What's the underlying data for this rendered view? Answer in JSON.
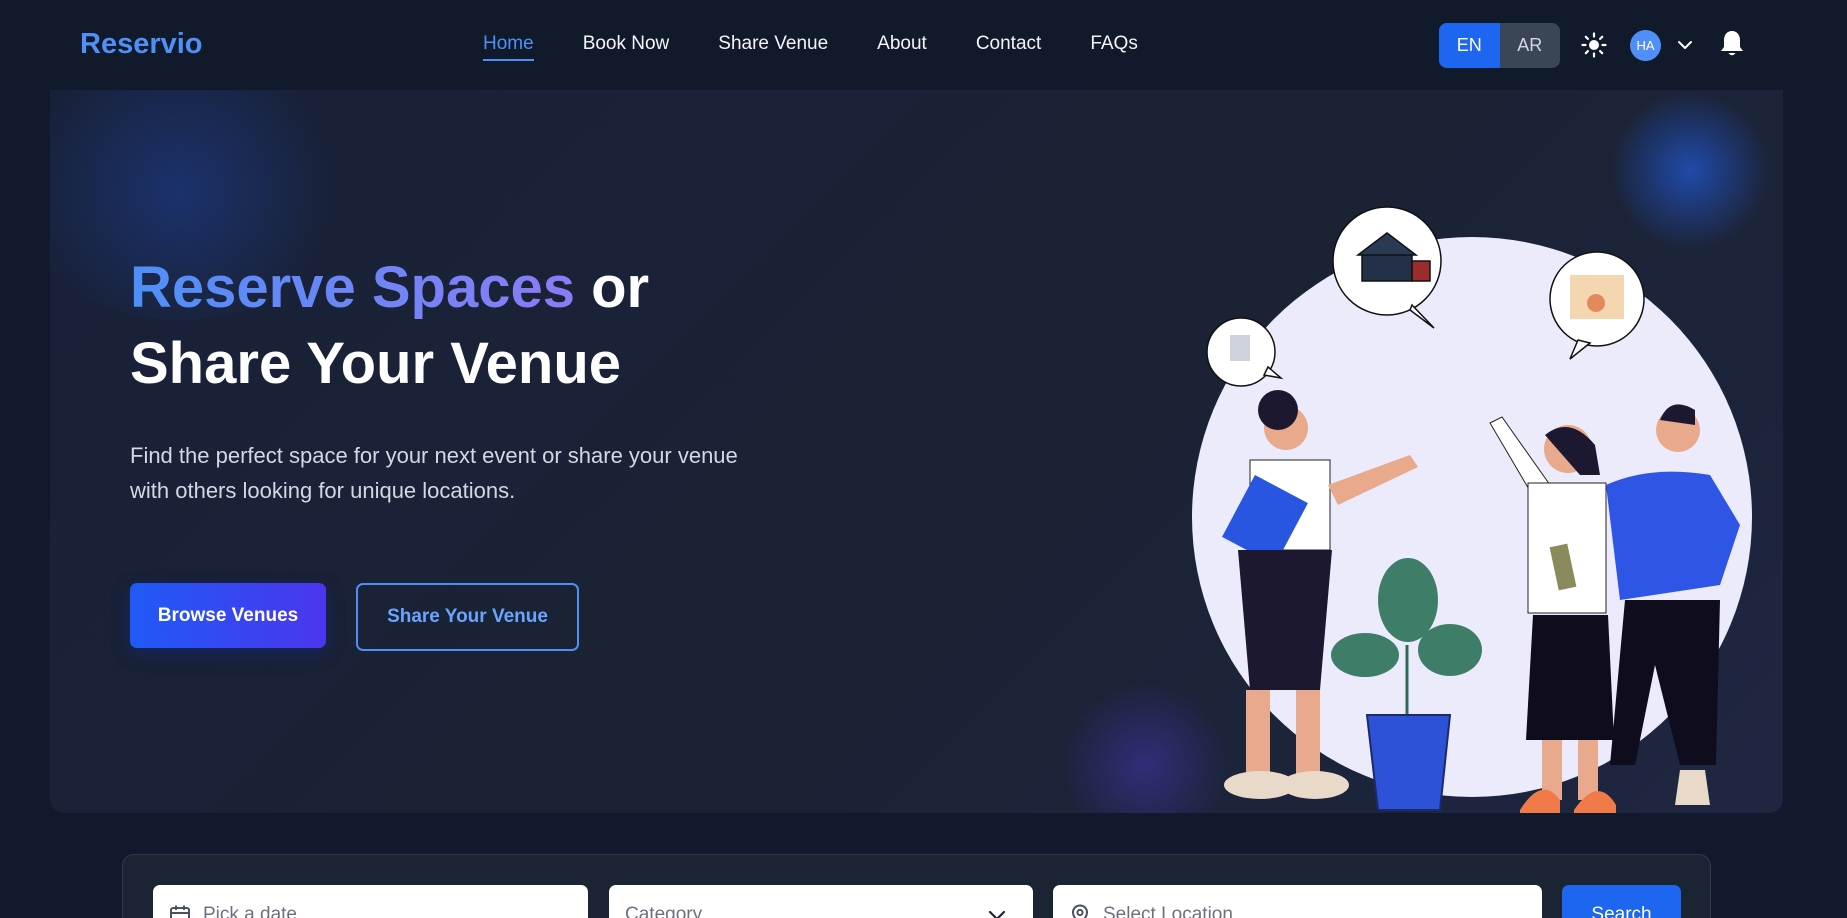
{
  "brand": "Reservio",
  "nav": {
    "links": [
      "Home",
      "Book Now",
      "Share Venue",
      "About",
      "Contact",
      "FAQs"
    ],
    "active": "Home"
  },
  "lang": {
    "en": "EN",
    "ar": "AR",
    "selected": "EN"
  },
  "user": {
    "initials": "HA"
  },
  "hero": {
    "title_highlight": "Reserve Spaces",
    "title_rest1": " or",
    "title_line2": "Share Your Venue",
    "subtitle": "Find the perfect space for your next event or share your venue with others looking for unique locations.",
    "primary_button": "Browse Venues",
    "secondary_button": "Share Your Venue"
  },
  "search": {
    "date_placeholder": "Pick a date",
    "category_placeholder": "Category",
    "location_placeholder": "Select Location",
    "button": "Search"
  },
  "colors": {
    "accent": "#4f8ff7",
    "primary_button": "#1c66f0",
    "background": "#101a2c"
  }
}
